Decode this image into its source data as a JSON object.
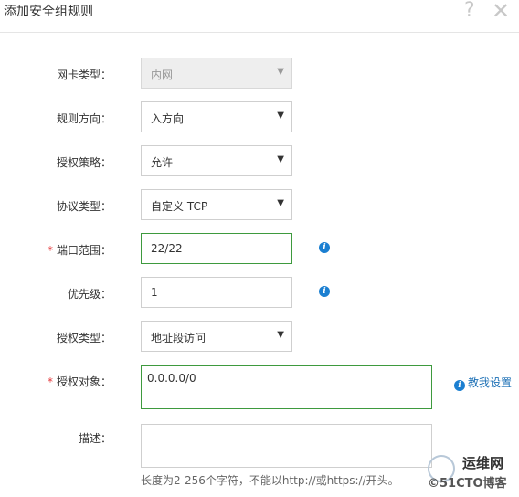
{
  "dialog": {
    "title": "添加安全组规则",
    "help_glyph": "?",
    "close_glyph": "✕"
  },
  "form": {
    "nic_type": {
      "label": "网卡类型：",
      "value": "内网",
      "disabled": true
    },
    "direction": {
      "label": "规则方向：",
      "value": "入方向"
    },
    "policy": {
      "label": "授权策略：",
      "value": "允许"
    },
    "protocol": {
      "label": "协议类型：",
      "value": "自定义 TCP"
    },
    "port_range": {
      "label": "端口范围：",
      "required_mark": "*",
      "value": "22/22"
    },
    "priority": {
      "label": "优先级：",
      "value": "1"
    },
    "auth_type": {
      "label": "授权类型：",
      "value": "地址段访问"
    },
    "auth_object": {
      "label": "授权对象：",
      "required_mark": "*",
      "value": "0.0.0.0/0",
      "help_link": "教我设置"
    },
    "description": {
      "label": "描述：",
      "value": "",
      "hint": "长度为2-256个字符，不能以http://或https://开头。"
    }
  },
  "icons": {
    "info": "i",
    "select_arrow": "▼"
  },
  "watermark": {
    "top": "运维网",
    "bottom": "©51CTO博客"
  }
}
